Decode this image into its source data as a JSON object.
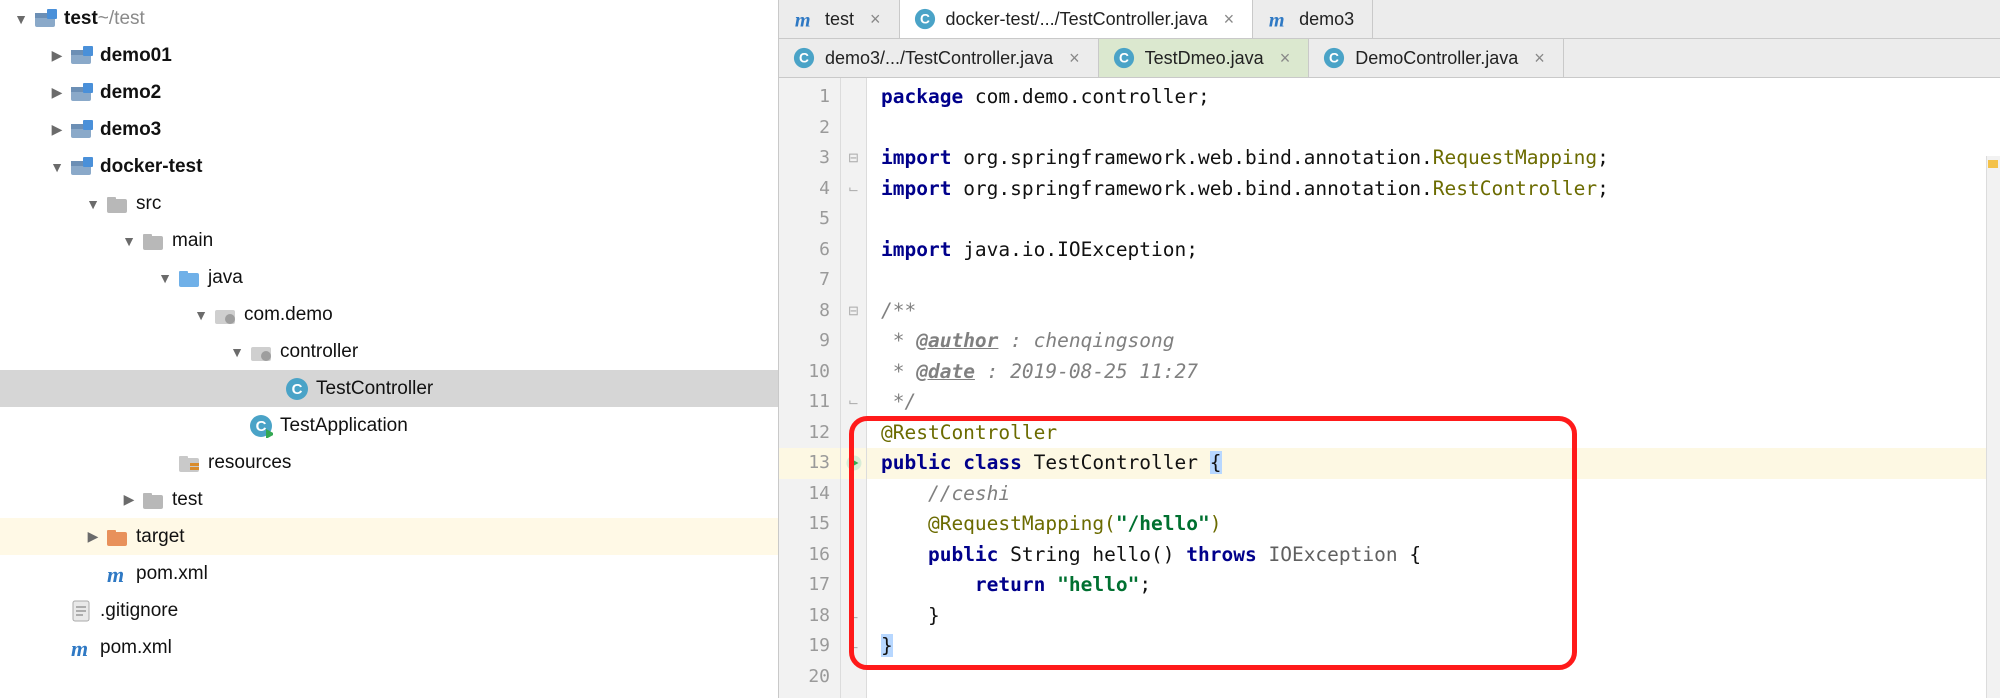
{
  "tree": {
    "root": {
      "name": "test",
      "suffix": "~/test"
    },
    "items": [
      {
        "indent": 0,
        "chev": "down",
        "icon": "module",
        "label": "test",
        "bold": true,
        "suffix": "~/test"
      },
      {
        "indent": 1,
        "chev": "right",
        "icon": "module",
        "label": "demo01",
        "bold": true
      },
      {
        "indent": 1,
        "chev": "right",
        "icon": "module",
        "label": "demo2",
        "bold": true
      },
      {
        "indent": 1,
        "chev": "right",
        "icon": "module",
        "label": "demo3",
        "bold": true
      },
      {
        "indent": 1,
        "chev": "down",
        "icon": "module",
        "label": "docker-test",
        "bold": true
      },
      {
        "indent": 2,
        "chev": "down",
        "icon": "folder",
        "label": "src"
      },
      {
        "indent": 3,
        "chev": "down",
        "icon": "folder",
        "label": "main"
      },
      {
        "indent": 4,
        "chev": "down",
        "icon": "src-folder",
        "label": "java"
      },
      {
        "indent": 5,
        "chev": "down",
        "icon": "package",
        "label": "com.demo"
      },
      {
        "indent": 6,
        "chev": "down",
        "icon": "package",
        "label": "controller"
      },
      {
        "indent": 7,
        "chev": "none",
        "icon": "class",
        "label": "TestController",
        "selected": true
      },
      {
        "indent": 6,
        "chev": "none",
        "icon": "run-class",
        "label": "TestApplication"
      },
      {
        "indent": 4,
        "chev": "none",
        "icon": "res-folder",
        "label": "resources"
      },
      {
        "indent": 3,
        "chev": "right",
        "icon": "folder",
        "label": "test"
      },
      {
        "indent": 2,
        "chev": "right",
        "icon": "exc-folder",
        "label": "target",
        "hl": "orange"
      },
      {
        "indent": 2,
        "chev": "none",
        "icon": "maven",
        "label": "pom.xml"
      },
      {
        "indent": 1,
        "chev": "none",
        "icon": "textfile",
        "label": ".gitignore"
      },
      {
        "indent": 1,
        "chev": "none",
        "icon": "maven",
        "label": "pom.xml"
      }
    ]
  },
  "tabsTop": [
    {
      "icon": "maven",
      "label": "test",
      "state": "inactive",
      "closable": true
    },
    {
      "icon": "class",
      "label": "docker-test/.../TestController.java",
      "state": "active",
      "closable": true
    },
    {
      "icon": "maven",
      "label": "demo3",
      "state": "inactive",
      "closable": false
    }
  ],
  "tabsBottom": [
    {
      "icon": "class",
      "label": "demo3/.../TestController.java",
      "state": "inactive",
      "closable": true
    },
    {
      "icon": "class",
      "label": "TestDmeo.java",
      "state": "greenish",
      "closable": true
    },
    {
      "icon": "class",
      "label": "DemoController.java",
      "state": "inactive",
      "closable": true
    }
  ],
  "gutter": {
    "start": 1,
    "end": 20
  },
  "code": {
    "l1": {
      "kw": "package",
      "rest": " com.demo.controller;"
    },
    "l3": {
      "kw": "import",
      "p1": " org.springframework.web.bind.annotation.",
      "ann": "RequestMapping",
      "p2": ";"
    },
    "l4": {
      "kw": "import",
      "p1": " org.springframework.web.bind.annotation.",
      "ann": "RestController",
      "p2": ";"
    },
    "l6": {
      "kw": "import",
      "rest": " java.io.IOException;"
    },
    "l8": "/**",
    "l9a": " * ",
    "l9tag": "@author",
    "l9b": " : chenqingsong",
    "l10a": " * ",
    "l10tag": "@date",
    "l10b": " : 2019-08-25 11:27",
    "l11": " */",
    "l12": "@RestController",
    "l13a": "public",
    "l13b": "class",
    "l13c": " TestController ",
    "l13d": "{",
    "l14": "    //ceshi",
    "l15a": "    @RequestMapping(",
    "l15s": "\"/hello\"",
    "l15b": ")",
    "l16a": "    ",
    "l16k1": "public",
    "l16b": " String hello() ",
    "l16k2": "throws",
    "l16c": " ",
    "l16t": "IOException",
    "l16d": " {",
    "l17a": "        ",
    "l17k": "return",
    "l17b": " ",
    "l17s": "\"hello\"",
    "l17c": ";",
    "l18": "    }",
    "l19": "}"
  }
}
